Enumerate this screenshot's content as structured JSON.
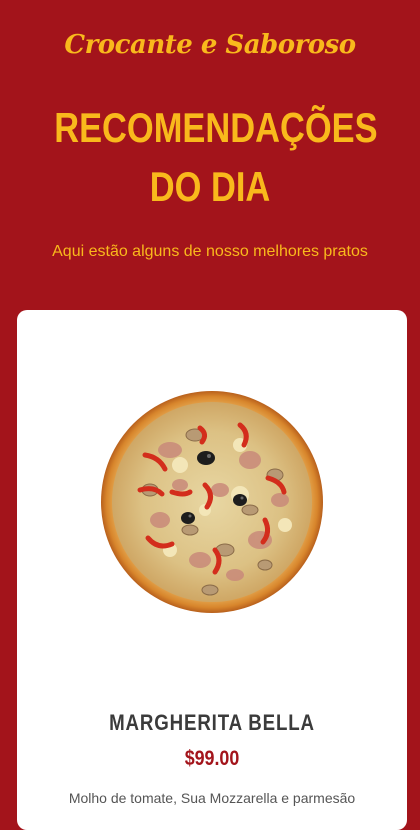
{
  "header": {
    "tagline": "Crocante e Saboroso",
    "title": "RECOMENDAÇÕES DO DIA",
    "subtitle": "Aqui estão alguns de nosso melhores pratos"
  },
  "featured_dish": {
    "image_icon": "pizza-image",
    "name": "MARGHERITA BELLA",
    "price": "$99.00",
    "description": "Molho de tomate, Sua Mozzarella e parmesão"
  },
  "colors": {
    "background": "#a3141b",
    "accent": "#f9b91c",
    "card": "#ffffff",
    "price": "#a3141b",
    "heading": "#3b3b3b"
  }
}
